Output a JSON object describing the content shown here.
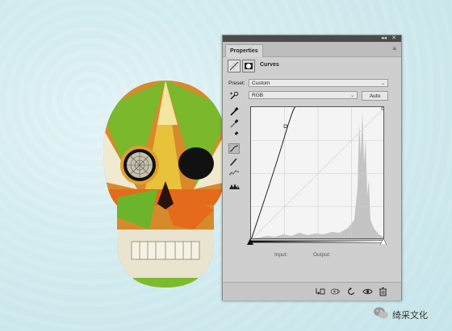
{
  "panel": {
    "tab_label": "Properties",
    "collapse_glyph": "◂◂",
    "close_glyph": "✕",
    "menu_glyph": "≡",
    "adjustment_title": "Curves",
    "preset_label": "Preset:",
    "preset_value": "Custom",
    "channel_value": "RGB",
    "auto_label": "Auto",
    "input_label": "Input:",
    "output_label": "Output:",
    "tools": [
      "sample-in-image-icon",
      "black-point-eyedropper-icon",
      "gray-point-eyedropper-icon",
      "white-point-eyedropper-icon",
      "edit-points-icon",
      "pencil-icon",
      "smooth-icon",
      "clipping-warning-icon"
    ],
    "bottom_icons": [
      "clip-to-layer-icon",
      "view-previous-icon",
      "reset-icon",
      "visibility-icon",
      "trash-icon"
    ]
  },
  "watermark": {
    "text": "绮采文化",
    "logo": "wechat-logo-icon"
  }
}
